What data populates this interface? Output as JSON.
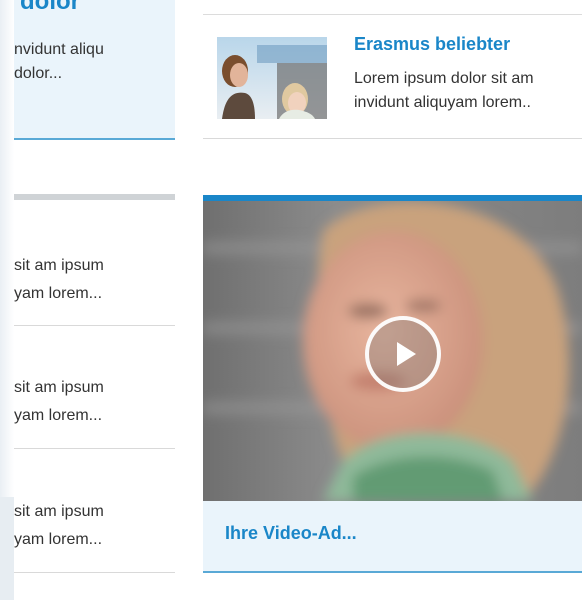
{
  "left_column": {
    "top_card": {
      "title": "dolor",
      "text_line1": "nvidunt aliqu",
      "text_line2": "dolor..."
    },
    "items": [
      {
        "line1": "sit am ipsum",
        "line2": "yam lorem..."
      },
      {
        "line1": "sit am ipsum",
        "line2": "yam lorem..."
      },
      {
        "line1": "sit am ipsum",
        "line2": "yam lorem..."
      }
    ]
  },
  "right_column": {
    "article": {
      "title": "Erasmus beliebter",
      "text_line1": "Lorem ipsum dolor sit am",
      "text_line2": "invidunt aliquyam lorem..",
      "thumbnail_icon": "photo-thumbnail"
    },
    "video": {
      "play_icon": "play-icon",
      "caption": "Ihre Video-Ad..."
    }
  },
  "colors": {
    "accent_blue": "#1a86c8",
    "light_blue_bg": "#eaf4fb",
    "border_blue": "#59a9d6",
    "text_dark": "#333333",
    "divider_gray": "#cfd3d6"
  }
}
